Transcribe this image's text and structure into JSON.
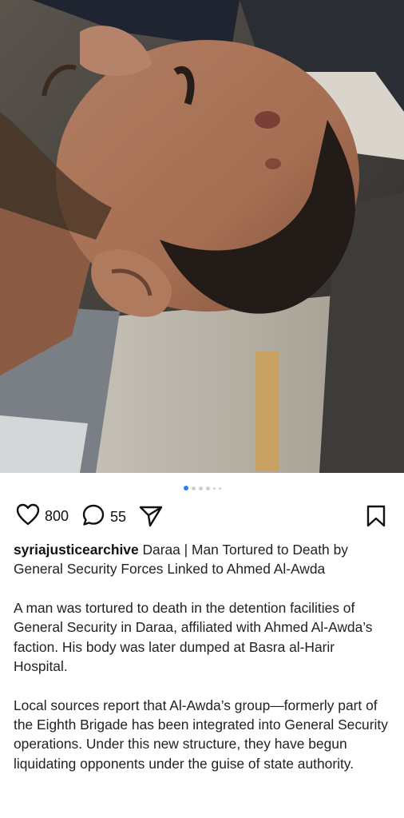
{
  "post": {
    "image_alt": "",
    "carousel": {
      "count": 6,
      "active_index": 0,
      "accent": "#2f7df6"
    },
    "likes": "800",
    "comments": "55",
    "username": "syriajusticearchive",
    "title": "Daraa | Man Tortured to Death by General Security Forces Linked to Ahmed Al-Awda",
    "paragraphs": [
      "A man was tortured to death in the detention facilities of General Security in Daraa, affiliated with Ahmed Al-Awda’s faction. His body was later dumped at Basra al-Harir Hospital.",
      "Local sources report that Al-Awda’s group—formerly part of the Eighth Brigade has been integrated into General Security operations. Under this new structure, they have begun liquidating opponents under the guise of state authority."
    ]
  },
  "icons": {
    "like": "heart-icon",
    "comment": "comment-bubble-icon",
    "share": "send-icon",
    "save": "bookmark-icon"
  }
}
